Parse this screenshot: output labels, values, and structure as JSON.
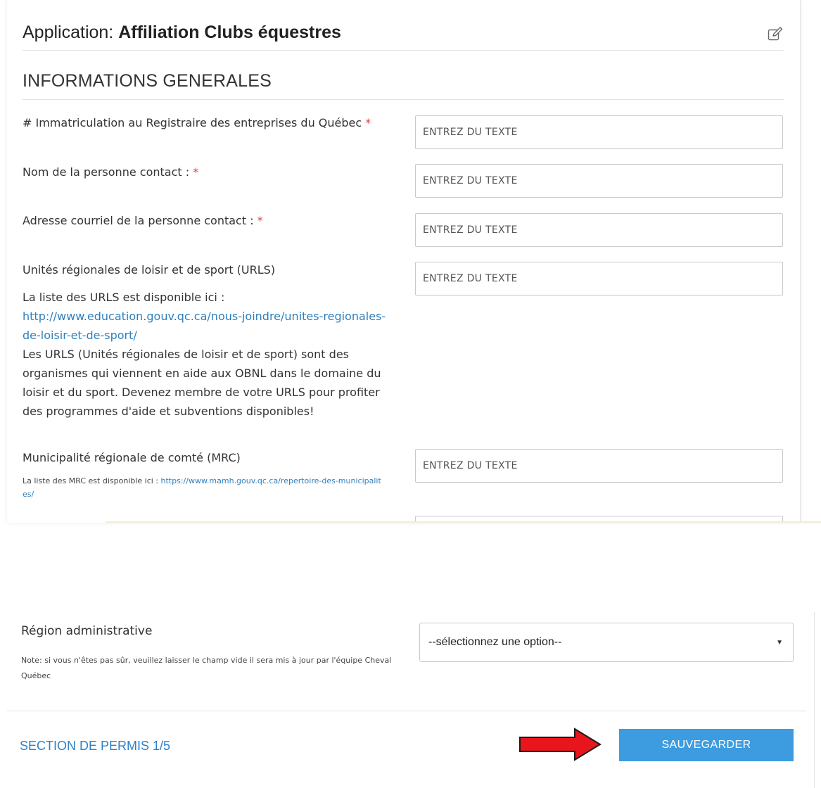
{
  "header": {
    "app_prefix": "Application: ",
    "app_name": "Affiliation Clubs équestres"
  },
  "section": {
    "title": "INFORMATIONS GENERALES"
  },
  "fields": [
    {
      "label": "# Immatriculation au Registraire des entreprises du Québec",
      "required_mark": "*",
      "placeholder": "ENTREZ DU TEXTE"
    },
    {
      "label": "Nom de la personne contact :",
      "required_mark": "*",
      "placeholder": "ENTREZ DU TEXTE"
    },
    {
      "label": "Adresse courriel de la personne contact :",
      "required_mark": "*",
      "placeholder": "ENTREZ DU TEXTE"
    },
    {
      "label": "Unités régionales de loisir et de sport (URLS)",
      "placeholder": "ENTREZ DU TEXTE"
    },
    {
      "label": "Municipalité régionale de comté (MRC)",
      "placeholder": "ENTREZ DU TEXTE"
    }
  ],
  "urls_help": {
    "intro": "La liste des URLS est disponible ici :",
    "link": "http://www.education.gouv.qc.ca/nous-joindre/unites-regionales-de-loisir-et-de-sport/",
    "description": "Les URLS (Unités régionales de loisir et de sport) sont des organismes qui viennent en aide aux OBNL dans le domaine du loisir et du sport. Devenez membre de votre URLS pour profiter des programmes d'aide et subventions disponibles!"
  },
  "mrc_help": {
    "intro": "La liste des MRC est disponible ici : ",
    "link": "https://www.mamh.gouv.qc.ca/repertoire-des-municipalites/"
  },
  "region": {
    "label": "Région administrative",
    "note": "Note: si vous n'êtes pas sûr, veuillez laisser le champ vide il sera mis à jour par l'équipe Cheval Québec",
    "selected": "--sélectionnez une option--"
  },
  "footer": {
    "permit_section": "SECTION DE PERMIS 1/5",
    "save_label": "SAUVEGARDER"
  },
  "colors": {
    "accent_blue": "#3d9be0",
    "link_blue": "#2f7fbd",
    "required_red": "#e23b3b",
    "arrow_red": "#e8161c"
  }
}
